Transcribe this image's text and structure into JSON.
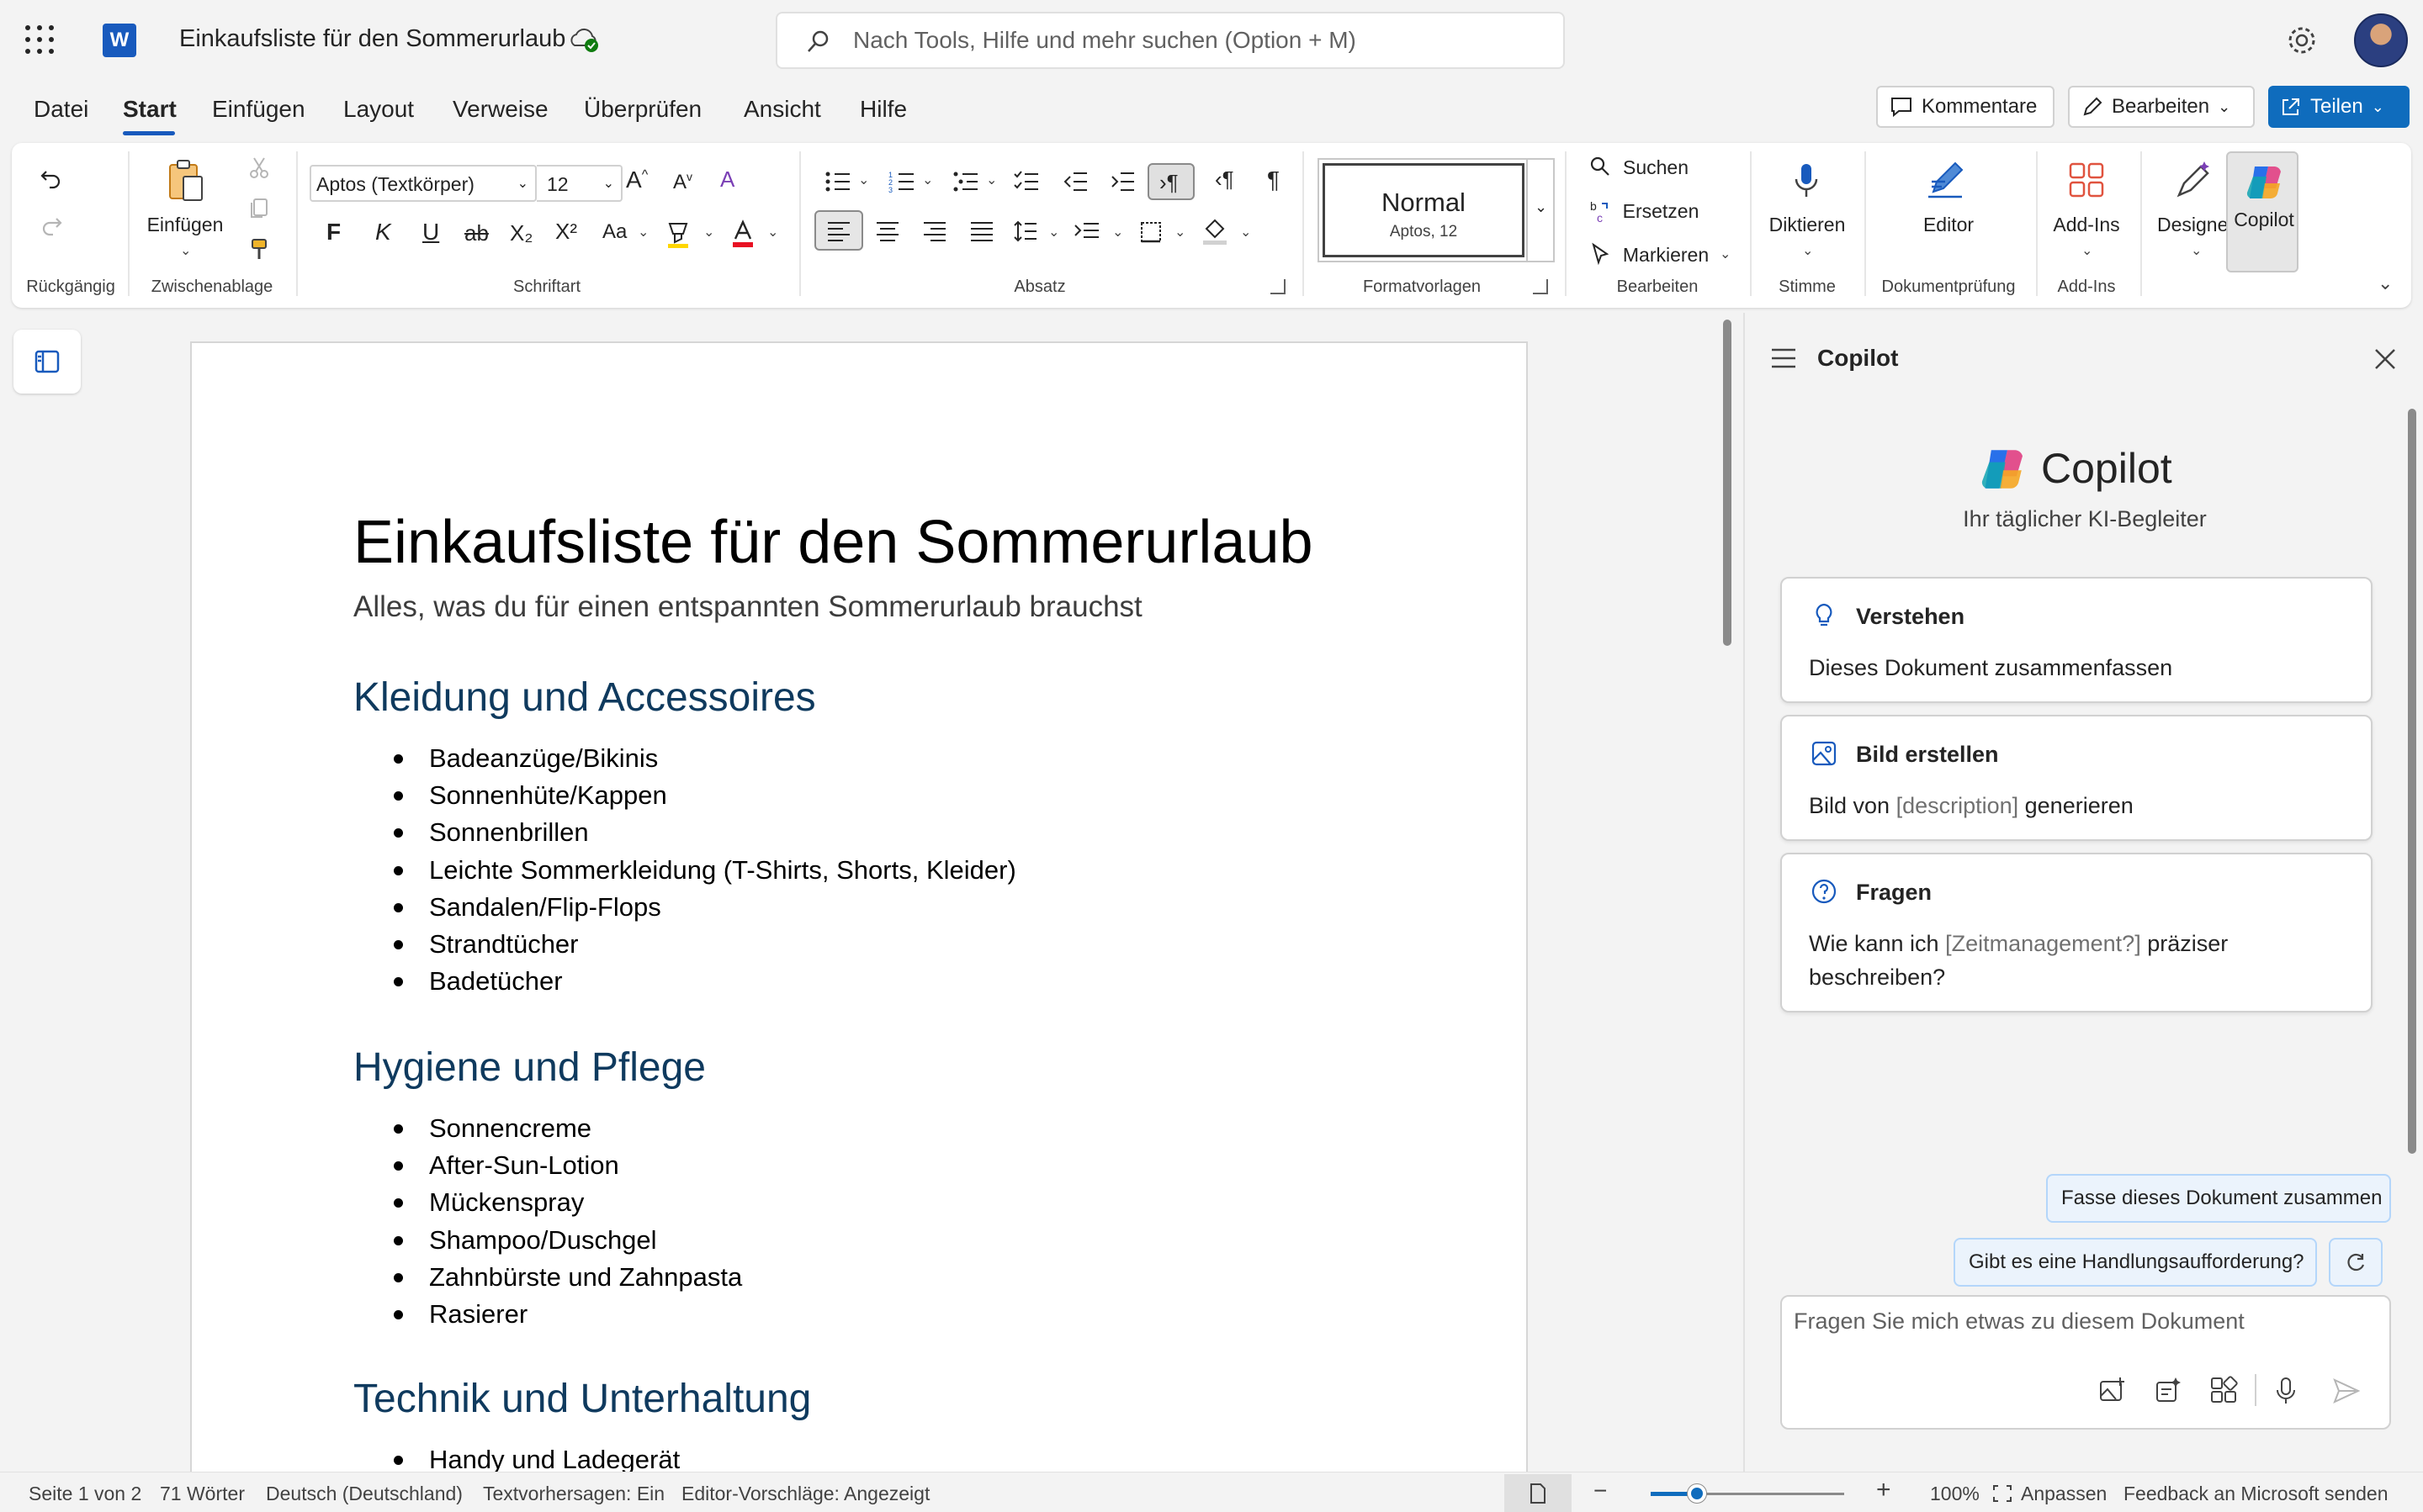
{
  "titlebar": {
    "app_icon": "word-logo-icon",
    "doc_title": "Einkaufsliste für den Sommerurlaub",
    "search_placeholder": "Nach Tools, Hilfe und mehr suchen (Option + M)"
  },
  "menu": {
    "tabs": [
      "Datei",
      "Start",
      "Einfügen",
      "Layout",
      "Verweise",
      "Überprüfen",
      "Ansicht",
      "Hilfe"
    ],
    "active_tab": "Start",
    "comments_label": "Kommentare",
    "edit_label": "Bearbeiten",
    "share_label": "Teilen"
  },
  "ribbon": {
    "undo_group": "Rückgängig",
    "clipboard": {
      "paste_label": "Einfügen",
      "group": "Zwischenablage"
    },
    "font": {
      "family": "Aptos (Textkörper)",
      "size": "12",
      "group": "Schriftart",
      "bold": "F",
      "italic": "K",
      "underline": "U",
      "strike": "ab",
      "sub": "X₂",
      "sup": "X²"
    },
    "paragraph": {
      "group": "Absatz"
    },
    "styles": {
      "current": "Normal",
      "current_sub": "Aptos, 12",
      "group": "Formatvorlagen"
    },
    "editing": {
      "find": "Suchen",
      "replace": "Ersetzen",
      "select": "Markieren",
      "group": "Bearbeiten"
    },
    "voice": {
      "dictate": "Diktieren",
      "group": "Stimme"
    },
    "proofing": {
      "editor": "Editor",
      "group": "Dokumentprüfung"
    },
    "addins": {
      "label": "Add-Ins",
      "group": "Add-Ins"
    },
    "designer": "Designer",
    "copilot": "Copilot",
    "accent_color": "#185abd"
  },
  "document": {
    "title": "Einkaufsliste für den Sommerurlaub",
    "subtitle": "Alles, was du für einen entspannten Sommerurlaub brauchst",
    "sections": [
      {
        "heading": "Kleidung und Accessoires",
        "items": [
          "Badeanzüge/Bikinis",
          "Sonnenhüte/Kappen",
          "Sonnenbrillen",
          "Leichte Sommerkleidung (T-Shirts, Shorts, Kleider)",
          "Sandalen/Flip-Flops",
          "Strandtücher",
          "Badetücher"
        ]
      },
      {
        "heading": "Hygiene und Pflege",
        "items": [
          "Sonnencreme",
          "After-Sun-Lotion",
          "Mückenspray",
          "Shampoo/Duschgel",
          "Zahnbürste und Zahnpasta",
          "Rasierer"
        ]
      },
      {
        "heading": "Technik und Unterhaltung",
        "items": [
          "Handy und Ladegerät"
        ]
      }
    ],
    "heading_color": "#0f3a5e"
  },
  "copilot": {
    "pane_title": "Copilot",
    "brand": "Copilot",
    "tagline": "Ihr täglicher KI-Begleiter",
    "cards": [
      {
        "icon": "lightbulb-icon",
        "title": "Verstehen",
        "text": "Dieses Dokument zusammenfassen"
      },
      {
        "icon": "image-icon",
        "title": "Bild erstellen",
        "text_pre": "Bild von ",
        "placeholder": "[description]",
        "text_post": " generieren"
      },
      {
        "icon": "question-icon",
        "title": "Fragen",
        "text_pre": "Wie kann ich ",
        "placeholder": "[Zeitmanagement?]",
        "text_post": " präziser beschreiben?"
      }
    ],
    "suggestions": [
      "Fasse dieses Dokument zusammen",
      "Gibt es eine Handlungsaufforderung?"
    ],
    "input_placeholder": "Fragen Sie mich etwas zu diesem Dokument"
  },
  "statusbar": {
    "page": "Seite 1 von 2",
    "words": "71 Wörter",
    "language": "Deutsch (Deutschland)",
    "predictions": "Textvorhersagen: Ein",
    "editor_suggestions": "Editor-Vorschläge: Angezeigt",
    "zoom": "100%",
    "fit": "Anpassen",
    "feedback": "Feedback an Microsoft senden"
  }
}
